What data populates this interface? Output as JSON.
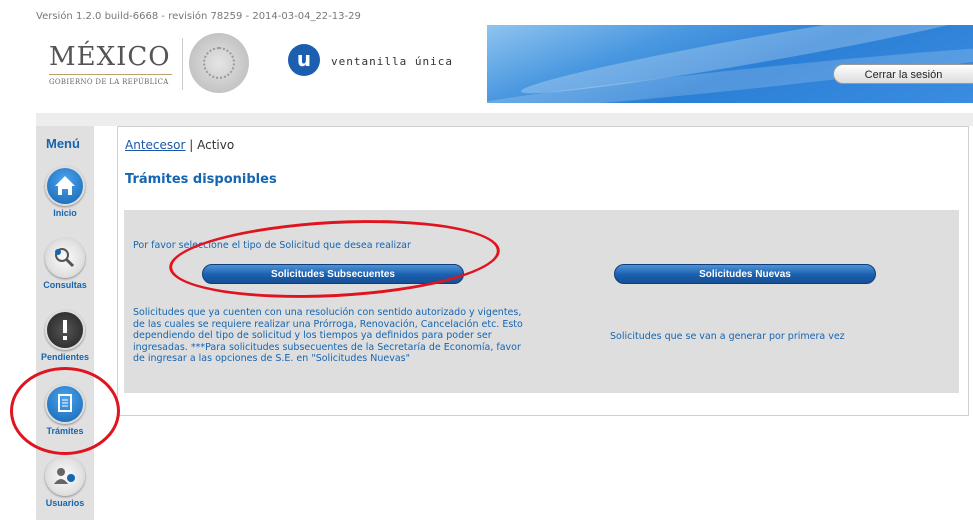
{
  "version": "Versión 1.2.0 build-6668 - revisión 78259 - 2014-03-04_22-13-29",
  "header": {
    "mexico": "MÉXICO",
    "gobierno": "GOBIERNO DE LA REPÚBLICA",
    "logo_letter": "u",
    "brand": "ventanilla única",
    "logout": "Cerrar la sesión"
  },
  "sidebar": {
    "title": "Menú",
    "items": [
      {
        "label": "Inicio",
        "icon": "home-icon",
        "color": "#1565b0"
      },
      {
        "label": "Consultas",
        "icon": "magnifier-icon",
        "color": "#f0f0f0"
      },
      {
        "label": "Pendientes",
        "icon": "alert-icon",
        "color": "#333333"
      },
      {
        "label": "Trámites",
        "icon": "document-icon",
        "color": "#1565b0"
      },
      {
        "label": "Usuarios",
        "icon": "users-icon",
        "color": "#f0f0f0"
      }
    ]
  },
  "breadcrumb": {
    "link": "Antecesor",
    "separator": " | ",
    "current": "Activo"
  },
  "page_title": "Trámites disponibles",
  "prompt": "Por favor seleccione el tipo de Solicitud que desea realizar",
  "buttons": {
    "subsecuentes": "Solicitudes Subsecuentes",
    "nuevas": "Solicitudes Nuevas"
  },
  "desc_subsecuentes": "Solicitudes que ya cuenten con una resolución con sentido autorizado y vigentes, de las cuales se requiere realizar una Prórroga, Renovación, Cancelación etc. Esto dependiendo del tipo de solicitud y los tiempos ya definidos para poder ser ingresadas. ***Para solicitudes subsecuentes de la Secretaría de Economía, favor de ingresar a las opciones de S.E. en \"Solicitudes Nuevas\"",
  "desc_nuevas": "Solicitudes que se van a generar por primera vez",
  "colors": {
    "accent": "#1565b0",
    "annotation": "#e0141e"
  }
}
